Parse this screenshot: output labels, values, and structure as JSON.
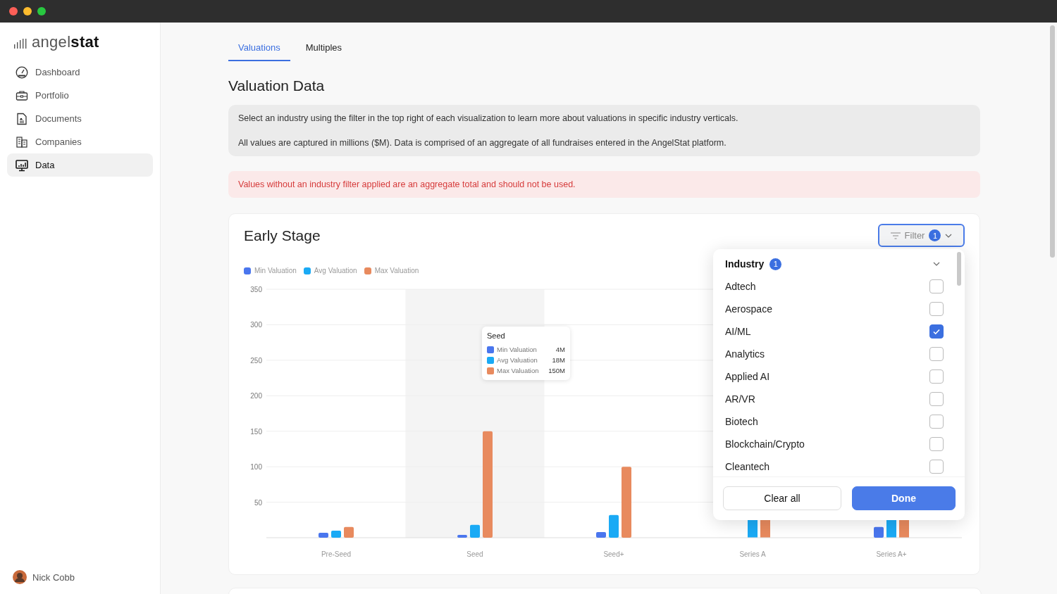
{
  "window": {
    "controls": [
      {
        "color": "#fe5f57"
      },
      {
        "color": "#febc2e"
      },
      {
        "color": "#28c840"
      }
    ]
  },
  "sidebar": {
    "logo": "angel**stat**",
    "items": [
      {
        "label": "Dashboard",
        "selected": false
      },
      {
        "label": "Portfolio",
        "selected": false
      },
      {
        "label": "Documents",
        "selected": false
      },
      {
        "label": "Companies",
        "selected": false
      },
      {
        "label": "Data",
        "selected": true
      }
    ],
    "user": {
      "name": "Nick Cobb"
    }
  },
  "tabs": [
    {
      "label": "Valuations",
      "selected": true
    },
    {
      "label": "Multiples",
      "selected": false
    }
  ],
  "heading": "Valuation Data",
  "info": [
    "Select an industry using the filter in the top right of each visualization to learn more about valuations in specific industry verticals.",
    "All values are captured in millions ($M). Data is comprised of an aggregate of all fundraises entered in the AngelStat platform."
  ],
  "warning": "Values without an industry filter applied are an aggregate total and should not be used.",
  "card": {
    "title": "Early Stage",
    "filter": {
      "label": "Filter",
      "count": "1"
    },
    "tooltip": {
      "title": "Seed",
      "rows": [
        {
          "label": "Min Valuation",
          "value": "4M",
          "color": "#4a76ee"
        },
        {
          "label": "Avg Valuation",
          "value": "18M",
          "color": "#1aaaf5"
        },
        {
          "label": "Max Valuation",
          "value": "150M",
          "color": "#e88a5e"
        }
      ]
    },
    "chart_data": {
      "type": "bar",
      "categories": [
        "Pre-Seed",
        "Seed",
        "Seed+",
        "Series A",
        "Series A+"
      ],
      "series": [
        {
          "name": "Min Valuation",
          "color": "#4a76ee",
          "values": [
            7,
            4,
            8,
            0,
            15
          ]
        },
        {
          "name": "Avg Valuation",
          "color": "#1aaaf5",
          "values": [
            10,
            18,
            32,
            null,
            null
          ]
        },
        {
          "name": "Max Valuation",
          "color": "#e88a5e",
          "values": [
            15,
            150,
            100,
            null,
            null
          ]
        }
      ],
      "ylim": [
        0,
        350
      ],
      "yticks": [
        50,
        100,
        150,
        200,
        250,
        300,
        350
      ],
      "grid": true
    },
    "dropdown": {
      "title": "Industry",
      "count": "1",
      "expanded": true,
      "options": [
        {
          "label": "Adtech",
          "checked": false
        },
        {
          "label": "Aerospace",
          "checked": false
        },
        {
          "label": "AI/ML",
          "checked": true
        },
        {
          "label": "Analytics",
          "checked": false
        },
        {
          "label": "Applied AI",
          "checked": false
        },
        {
          "label": "AR/VR",
          "checked": false
        },
        {
          "label": "Biotech",
          "checked": false
        },
        {
          "label": "Blockchain/Crypto",
          "checked": false
        },
        {
          "label": "Cleantech",
          "checked": false
        }
      ],
      "buttons": [
        {
          "label": "Clear all",
          "kind": "secondary"
        },
        {
          "label": "Done",
          "kind": "primary"
        }
      ]
    }
  }
}
